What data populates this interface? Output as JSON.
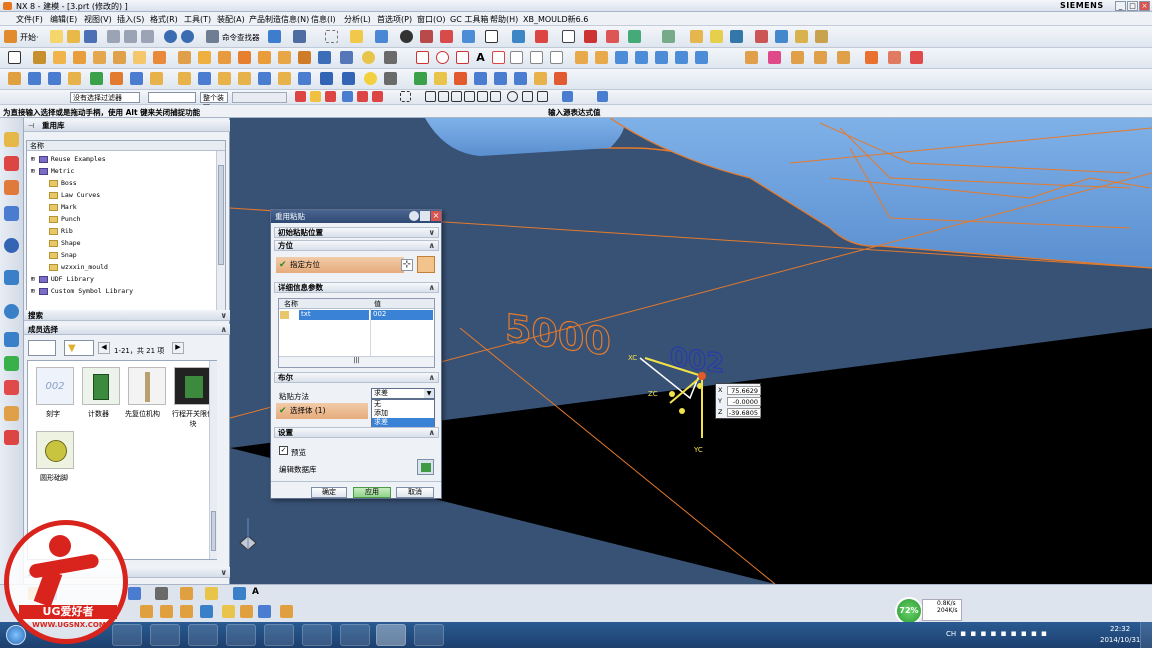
{
  "window": {
    "title": "NX 8 - 建模 - [3.prt  (修改的) ]",
    "brand": "SIEMENS",
    "controls": [
      "_",
      "□",
      "×"
    ]
  },
  "menubar": {
    "items": [
      "文件(F)",
      "编辑(E)",
      "视图(V)",
      "插入(S)",
      "格式(R)",
      "工具(T)",
      "装配(A)",
      "产品制造信息(N)",
      "信息(I)",
      "分析(L)",
      "首选项(P)",
      "窗口(O)",
      "GC 工具箱",
      "帮助(H)",
      "XB_MOULD新6.6"
    ]
  },
  "toolbar": {
    "start_label": "开始·",
    "cmd_finder": "命令查找器",
    "filter_select": "没有选择过滤器",
    "assembly_select": "整个装配",
    "cue": "为直接输入选择或是拖动手柄，使用 Alt 键来关闭捕捉功能",
    "status": "输入源表达式值"
  },
  "navpanel": {
    "title": "重用库",
    "column_header": "名称",
    "tree": [
      {
        "label": "Reuse Examples",
        "level": 1,
        "type": "lib"
      },
      {
        "label": "Metric",
        "level": 1,
        "type": "lib"
      },
      {
        "label": "Boss",
        "level": 2,
        "type": "folder"
      },
      {
        "label": "Law Curves",
        "level": 2,
        "type": "folder"
      },
      {
        "label": "Mark",
        "level": 2,
        "type": "folder"
      },
      {
        "label": "Punch",
        "level": 2,
        "type": "folder"
      },
      {
        "label": "Rib",
        "level": 2,
        "type": "folder"
      },
      {
        "label": "Shape",
        "level": 2,
        "type": "folder"
      },
      {
        "label": "Snap",
        "level": 2,
        "type": "folder"
      },
      {
        "label": "wzxxin_mould",
        "level": 2,
        "type": "folder"
      },
      {
        "label": "UDF Library",
        "level": 1,
        "type": "lib"
      },
      {
        "label": "Custom Symbol Library",
        "level": 1,
        "type": "lib"
      }
    ],
    "search_title": "搜索",
    "members_title": "成员选择",
    "pager": "1-21，共 21 项",
    "members": [
      {
        "label": "刻字"
      },
      {
        "label": "计数器"
      },
      {
        "label": "先复位机构"
      },
      {
        "label": "行程开关限位块"
      },
      {
        "label": "圆形础脚"
      }
    ],
    "preview_title": "预览"
  },
  "dialog": {
    "title": "重用粘贴",
    "section_init": "初始粘贴位置",
    "section_orient": "方位",
    "orient_row": "指定方位",
    "section_detail": "详细信息参数",
    "table_headers": [
      "名称",
      "值"
    ],
    "table_rows": [
      {
        "name": "txt",
        "value": "002"
      }
    ],
    "scroll_label": "|||",
    "section_bool": "布尔",
    "paste_method_label": "粘贴方法",
    "paste_method_value": "求差",
    "paste_method_options": [
      "无",
      "添加",
      "求差"
    ],
    "select_body": "选择体 (1)",
    "section_settings": "设置",
    "preview_label": "预览",
    "edit_db_label": "编辑数据库",
    "ok": "确定",
    "apply": "应用",
    "cancel": "取消"
  },
  "viewport": {
    "text_5000": "5000",
    "text_002": "002",
    "coords": [
      {
        "axis": "X",
        "value": "75.6629"
      },
      {
        "axis": "Y",
        "value": "-0.0000"
      },
      {
        "axis": "Z",
        "value": "-39.6805"
      }
    ],
    "axis_labels": [
      "XC",
      "ZC",
      "YC"
    ]
  },
  "taskbar": {
    "time": "22:32",
    "date": "2014/10/31",
    "cpu": "72%",
    "net_up": "0.8K/s",
    "net_down": "204K/s",
    "ime": "CH"
  },
  "watermark": {
    "brand": "UG爱好者",
    "url": "WWW.UGSNX.COM"
  }
}
